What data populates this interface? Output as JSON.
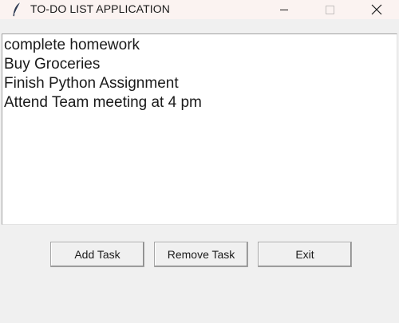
{
  "window": {
    "title": "TO-DO LIST APPLICATION",
    "icon": "feather-icon"
  },
  "tasks": [
    "complete homework",
    "Buy Groceries",
    "Finish Python Assignment",
    "Attend Team meeting at 4 pm"
  ],
  "buttons": {
    "add": "Add Task",
    "remove": "Remove Task",
    "exit": "Exit"
  }
}
